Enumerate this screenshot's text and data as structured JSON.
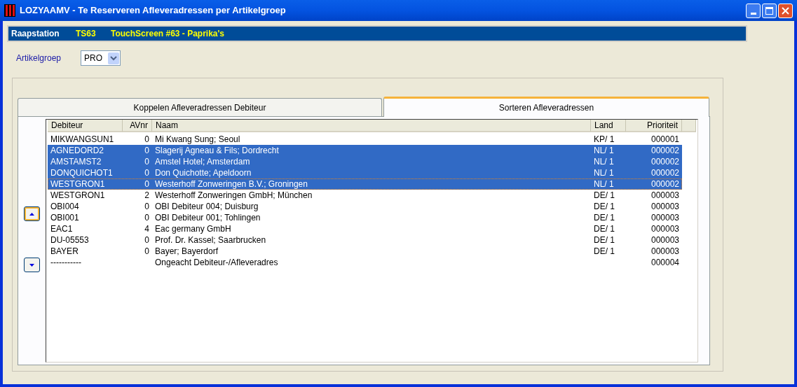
{
  "window": {
    "title": "LOZYAAMV - Te Reserveren Afleveradressen per Artikelgroep"
  },
  "info_bar": {
    "label": "Raapstation",
    "code": "TS63",
    "description": "TouchScreen #63 - Paprika's"
  },
  "artikelgroep": {
    "label": "Artikelgroep",
    "value": "PRO"
  },
  "tabs": [
    {
      "label": "Koppelen Afleveradressen Debiteur",
      "selected": false
    },
    {
      "label": "Sorteren Afleveradressen",
      "selected": true
    }
  ],
  "table": {
    "columns": [
      "Debiteur",
      "AVnr",
      "Naam",
      "Land",
      "Prioriteit"
    ],
    "rows": [
      {
        "cells": [
          "MIKWANGSUN1",
          "0",
          "Mi Kwang Sung; Seoul",
          "KP/ 1",
          "000001"
        ],
        "selected": false,
        "focused": false
      },
      {
        "cells": [
          "AGNEDORD2",
          "0",
          "Slagerij Agneau & Fils; Dordrecht",
          "NL/ 1",
          "000002"
        ],
        "selected": true,
        "focused": false
      },
      {
        "cells": [
          "AMSTAMST2",
          "0",
          "Amstel Hotel; Amsterdam",
          "NL/ 1",
          "000002"
        ],
        "selected": true,
        "focused": false
      },
      {
        "cells": [
          "DONQUICHOT1",
          "0",
          "Don Quichotte; Apeldoorn",
          "NL/ 1",
          "000002"
        ],
        "selected": true,
        "focused": false
      },
      {
        "cells": [
          "WESTGRON1",
          "0",
          "Westerhoff Zonweringen B.V.; Groningen",
          "NL/ 1",
          "000002"
        ],
        "selected": true,
        "focused": true
      },
      {
        "cells": [
          "WESTGRON1",
          "2",
          "Westerhoff Zonweringen GmbH; München",
          "DE/ 1",
          "000003"
        ],
        "selected": false,
        "focused": false
      },
      {
        "cells": [
          "OBI004",
          "0",
          "OBI Debiteur 004; Duisburg",
          "DE/ 1",
          "000003"
        ],
        "selected": false,
        "focused": false
      },
      {
        "cells": [
          "OBI001",
          "0",
          "OBI Debiteur 001; Tohlingen",
          "DE/ 1",
          "000003"
        ],
        "selected": false,
        "focused": false
      },
      {
        "cells": [
          "EAC1",
          "4",
          "Eac germany GmbH",
          "DE/ 1",
          "000003"
        ],
        "selected": false,
        "focused": false
      },
      {
        "cells": [
          "DU-05553",
          "0",
          "Prof. Dr. Kassel; Saarbrucken",
          "DE/ 1",
          "000003"
        ],
        "selected": false,
        "focused": false
      },
      {
        "cells": [
          "BAYER",
          "0",
          "Bayer; Bayerdorf",
          "DE/ 1",
          "000003"
        ],
        "selected": false,
        "focused": false
      },
      {
        "cells": [
          "-----------",
          "",
          "Ongeacht Debiteur-/Afleveradres",
          "",
          "000004"
        ],
        "selected": false,
        "focused": false
      }
    ]
  }
}
